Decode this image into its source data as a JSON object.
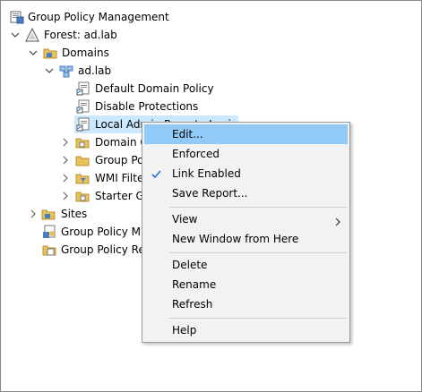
{
  "tree": {
    "root": "Group Policy Management",
    "forest": "Forest: ad.lab",
    "domains": "Domains",
    "domain": "ad.lab",
    "gpo1": "Default Domain Policy",
    "gpo2": "Disable Protections",
    "gpo3": "Local Admin Remote Logi",
    "ou_domain": "Domain C",
    "ou_group": "Group Po",
    "ou_wmi": "WMI Filte",
    "ou_starter": "Starter G",
    "sites": "Sites",
    "modeling": "Group Policy M",
    "results": "Group Policy Re"
  },
  "menu": {
    "edit": "Edit...",
    "enforced": "Enforced",
    "link_enabled": "Link Enabled",
    "save_report": "Save Report...",
    "view": "View",
    "new_window": "New Window from Here",
    "delete": "Delete",
    "rename": "Rename",
    "refresh": "Refresh",
    "help": "Help"
  },
  "colors": {
    "selection": "#cce8ff",
    "menu_hover": "#91c9f7",
    "menu_bg": "#f2f2f2",
    "folder": "#e8c35a",
    "check": "#1f6fd1"
  },
  "icons": {
    "root": "gpm-icon",
    "forest": "forest-icon",
    "domain": "domain-icon",
    "gpo_link": "gpo-link-icon",
    "folder": "folder-icon",
    "check": "checkmark-icon",
    "submenu": "chevron-right-icon"
  }
}
